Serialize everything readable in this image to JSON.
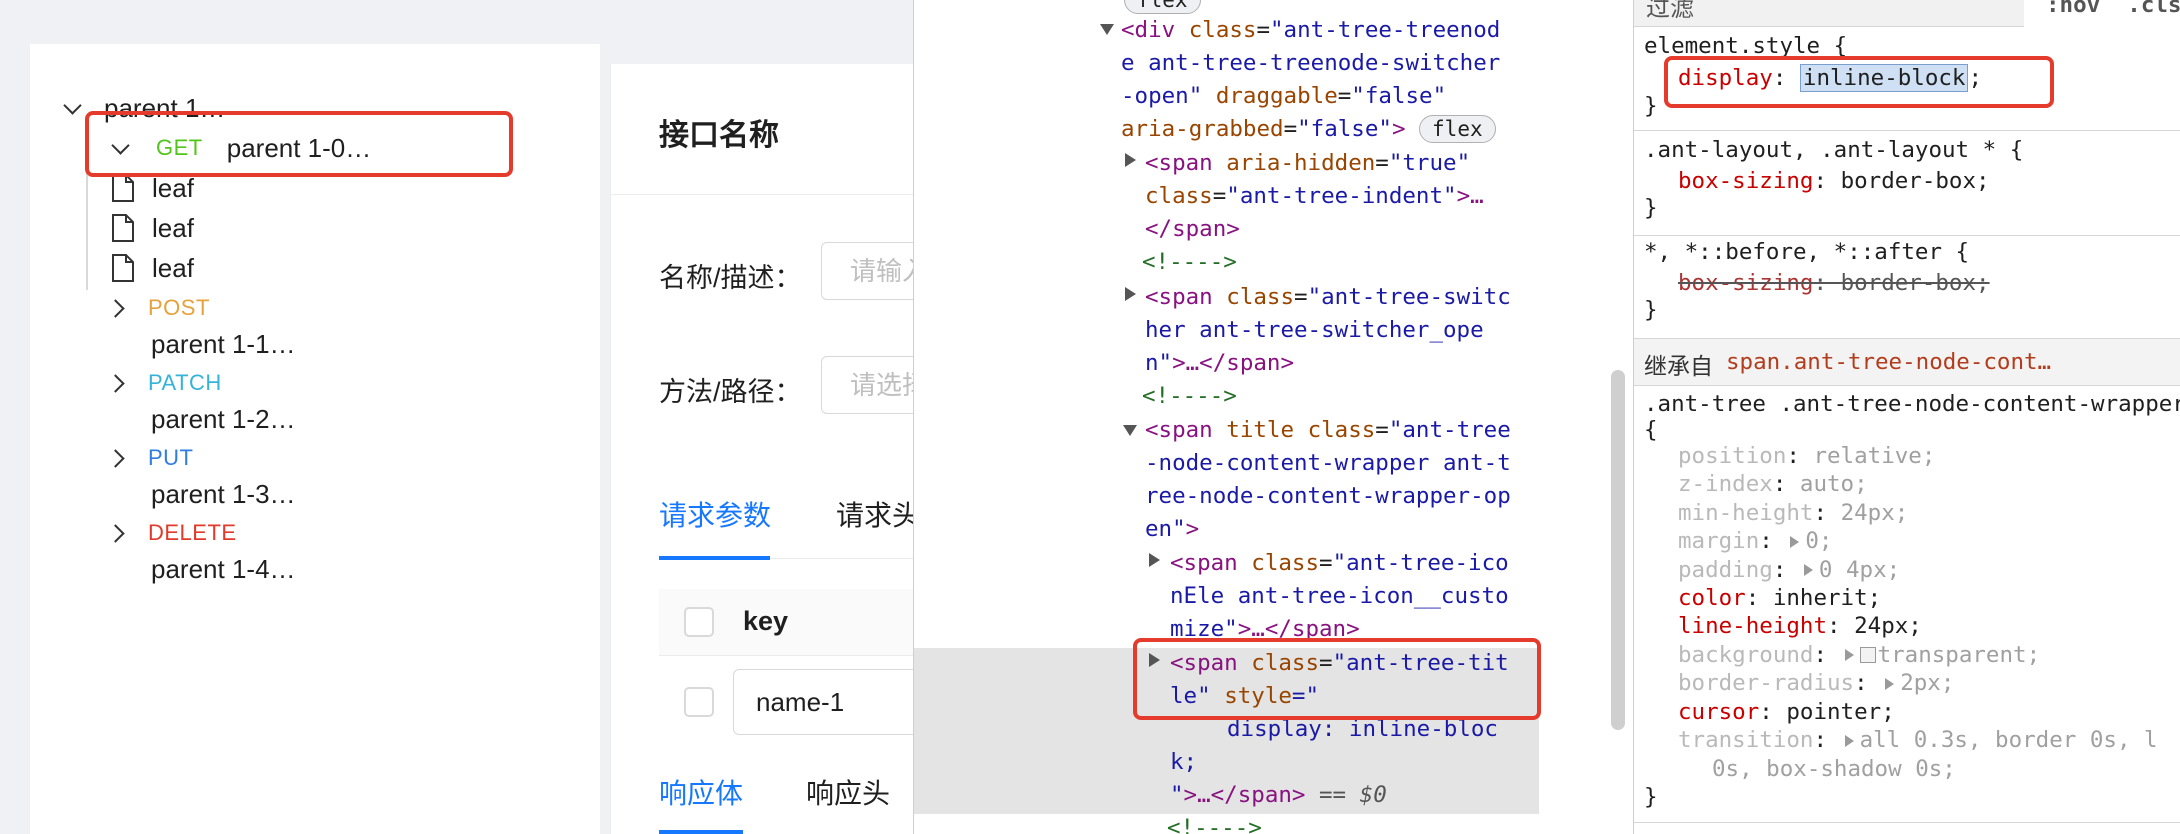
{
  "tree": {
    "root_label": "parent 1…",
    "selected": {
      "method": "GET",
      "label": "parent 1-0…"
    },
    "leaves": [
      "leaf",
      "leaf",
      "leaf"
    ],
    "nodes": [
      {
        "method": "POST",
        "label": "parent 1-1…",
        "color": "#e6a23c"
      },
      {
        "method": "PATCH",
        "label": "parent 1-2…",
        "color": "#36b3d9"
      },
      {
        "method": "PUT",
        "label": "parent 1-3…",
        "color": "#2f7de1"
      },
      {
        "method": "DELETE",
        "label": "parent 1-4…",
        "color": "#e03a2a"
      }
    ],
    "get_color": "#52c41a",
    "highlight_color": "#e53b2c"
  },
  "form": {
    "title": "接口名称",
    "name_label": "名称/描述：",
    "name_placeholder": "请输入",
    "method_label": "方法/路径：",
    "method_placeholder": "请选择",
    "tabs": [
      "请求参数",
      "请求头"
    ],
    "table_header": "key",
    "row_value": "name-1",
    "resp_tabs": [
      "响应体",
      "响应头"
    ],
    "accent": "#1677ff"
  },
  "elements": {
    "top_badge": "flex",
    "div_open": "<div",
    "div_class_attr": "class",
    "div_class_1": "\"ant-tree-treenod",
    "div_class_2": "e ant-tree-treenode-switcher",
    "div_class_3": "-open\"",
    "div_drag_attr": "draggable",
    "div_drag_val": "\"false\"",
    "div_aria_attr": "aria-grabbed",
    "div_aria_val": "\"false\"",
    "div_close": ">",
    "div_badge": "flex",
    "s1_open": "<span",
    "s1_attr": "aria-hidden",
    "s1_val": "\"true\"",
    "s1_class_attr": "class",
    "s1_class_val": "\"ant-tree-indent\"",
    "s1_end": ">…",
    "s1_close": "</span>",
    "comment": "<!---->",
    "s2_open": "<span",
    "s2_class_attr": "class",
    "s2_class_1": "\"ant-tree-switc",
    "s2_class_2": "her ant-tree-switcher_ope",
    "s2_class_3": "n\"",
    "s2_end": ">…</span>",
    "s3_open": "<span",
    "s3_title_attr": "title",
    "s3_class_attr": "class",
    "s3_class_1": "\"ant-tree",
    "s3_class_2": "-node-content-wrapper ant-t",
    "s3_class_3": "ree-node-content-wrapper-op",
    "s3_class_4": "en\"",
    "s3_end": ">",
    "s4_open": "<span",
    "s4_class_attr": "class",
    "s4_class_1": "\"ant-tree-ico",
    "s4_class_2": "nEle ant-tree-icon__custo",
    "s4_class_3": "mize\"",
    "s4_end": ">…</span>",
    "s5_open": "<span",
    "s5_class_attr": "class",
    "s5_class_1": "\"ant-tree-tit",
    "s5_class_2": "le\"",
    "s5_style_attr": "style",
    "s5_style_open": "=\"",
    "s5_style_1": "display: inline-bloc",
    "s5_style_2": "k;",
    "s5_style_close": "\"",
    "s5_end": ">…</span>",
    "s5_marker": " == $0",
    "bottom_comment": "<!---->"
  },
  "styles": {
    "filter_placeholder": "过滤",
    "hov": ":hov",
    "cls": ".cls",
    "element_style": "element.style {",
    "el_prop": "display",
    "el_val": "inline-block",
    "close": "}",
    "rule1_selector": ".ant-layout, .ant-layout * {",
    "rule1_prop": "box-sizing",
    "rule1_val": "border-box;",
    "rule2_selector": "*, *::before, *::after {",
    "rule2_prop": "box-sizing",
    "rule2_val": "border-box;",
    "inherit_label": "继承自",
    "inherit_sel": "span.ant-tree-node-cont…",
    "rule3_selector": ".ant-tree .ant-tree-node-content-wrapper",
    "rule3_open": "{",
    "decls": [
      {
        "p": "position",
        "v": "relative;",
        "dim": true
      },
      {
        "p": "z-index",
        "v": "auto;",
        "dim": true
      },
      {
        "p": "min-height",
        "v": "24px;",
        "dim": true
      },
      {
        "p": "margin",
        "v": "0;",
        "dim": true,
        "tri": true
      },
      {
        "p": "padding",
        "v": "0 4px;",
        "dim": true,
        "tri": true
      },
      {
        "p": "color",
        "v": "inherit;",
        "dim": false
      },
      {
        "p": "line-height",
        "v": "24px;",
        "dim": false
      },
      {
        "p": "background",
        "v": "transparent;",
        "dim": true,
        "tri": true,
        "sw": true
      },
      {
        "p": "border-radius",
        "v": "2px;",
        "dim": true,
        "tri": true
      },
      {
        "p": "cursor",
        "v": "pointer;",
        "dim": false
      },
      {
        "p": "transition",
        "v": "all 0.3s, border 0s, l",
        "dim": true,
        "tri": true
      }
    ],
    "transition_cont": "0s, box-shadow 0s;",
    "bottom_partial": "          .   .                        ."
  }
}
